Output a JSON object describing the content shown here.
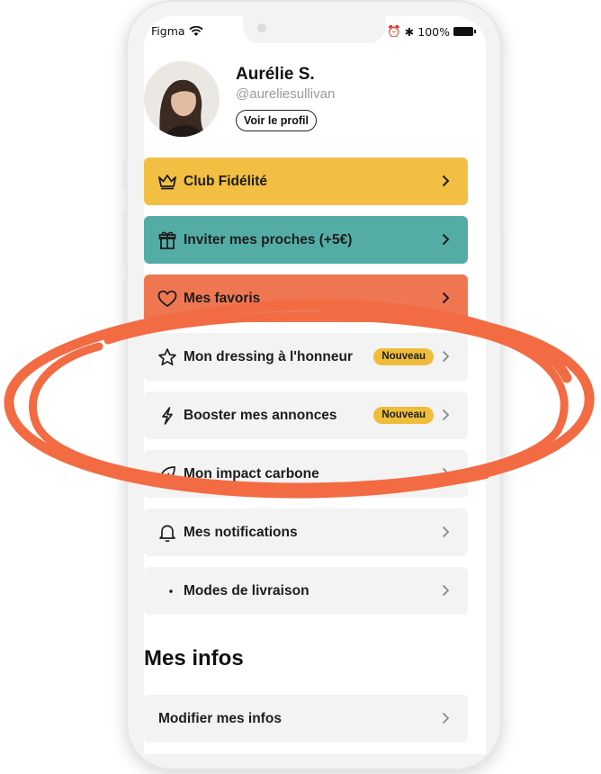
{
  "status_bar": {
    "carrier": "Figma",
    "battery": "100%"
  },
  "profile": {
    "name": "Aurélie S.",
    "handle": "@aureliesullivan",
    "view_profile_label": "Voir le profil"
  },
  "menu": [
    {
      "label": "Club Fidélité",
      "icon": "crown-icon",
      "color": "#f2bf43"
    },
    {
      "label": "Inviter mes proches (+5€)",
      "icon": "gift-icon",
      "color": "#54ada5"
    },
    {
      "label": "Mes favoris",
      "icon": "heart-icon",
      "color": "#ee7752"
    },
    {
      "label": "Mon dressing à l'honneur",
      "icon": "star-icon",
      "badge": "Nouveau"
    },
    {
      "label": "Booster mes annonces",
      "icon": "bolt-icon",
      "badge": "Nouveau"
    },
    {
      "label": "Mon impact carbone",
      "icon": "leaf-icon"
    },
    {
      "label": "Mes notifications",
      "icon": "bell-icon"
    },
    {
      "label": "Modes de livraison",
      "icon": "dot-icon"
    }
  ],
  "infos": {
    "title": "Mes infos",
    "items": [
      {
        "label": "Modifier mes infos"
      }
    ]
  },
  "colors": {
    "highlight_scribble": "#f26b43",
    "badge": "#f0bd3a"
  }
}
